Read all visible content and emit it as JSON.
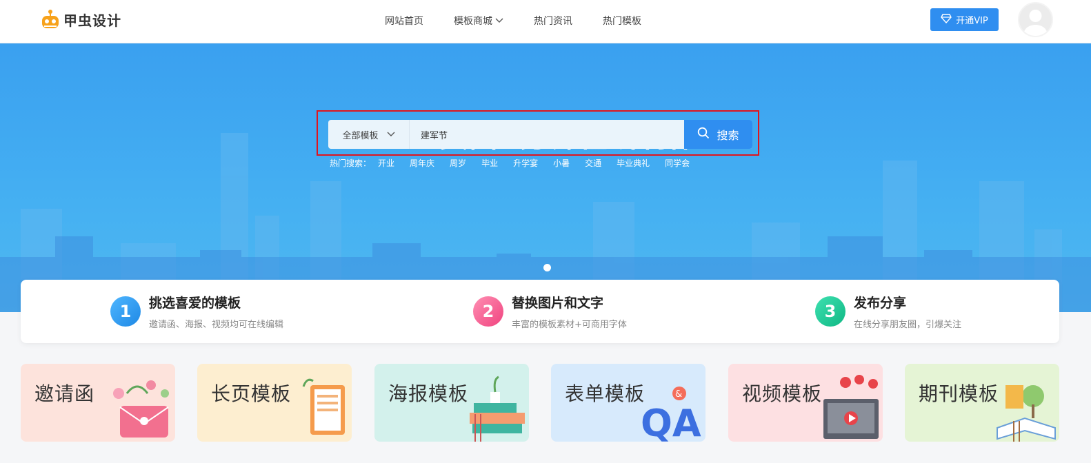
{
  "header": {
    "logo_text": "甲虫设计",
    "nav": [
      {
        "label": "网站首页"
      },
      {
        "label": "模板商城"
      },
      {
        "label": "热门资讯"
      },
      {
        "label": "热门模板"
      }
    ],
    "vip_label": "开通VIP"
  },
  "hero": {
    "title": "H5页面3分钟在线制作",
    "search": {
      "category": "全部模板",
      "value": "建军节",
      "button": "搜索"
    },
    "hot_label": "热门搜索：",
    "hot_items": [
      "开业",
      "周年庆",
      "周岁",
      "毕业",
      "升学宴",
      "小暑",
      "交通",
      "毕业典礼",
      "同学会"
    ]
  },
  "steps": [
    {
      "num": "1",
      "title": "挑选喜爱的模板",
      "desc": "邀请函、海报、视频均可在线编辑",
      "color": "#2196f3"
    },
    {
      "num": "2",
      "title": "替换图片和文字",
      "desc": "丰富的模板素材+可商用字体",
      "color": "#f4508c"
    },
    {
      "num": "3",
      "title": "发布分享",
      "desc": "在线分享朋友圈，引爆关注",
      "color": "#16c896"
    }
  ],
  "cards": [
    {
      "label": "邀请函",
      "bg": "#fde3dc"
    },
    {
      "label": "长页模板",
      "bg": "#fdeed0"
    },
    {
      "label": "海报模板",
      "bg": "#d3f1ec"
    },
    {
      "label": "表单模板",
      "bg": "#d7eafc"
    },
    {
      "label": "视频模板",
      "bg": "#fde0e2"
    },
    {
      "label": "期刊模板",
      "bg": "#e5f4d5"
    }
  ],
  "colors": {
    "brand_blue": "#2f8ef0",
    "highlight_red": "#e1141c"
  }
}
